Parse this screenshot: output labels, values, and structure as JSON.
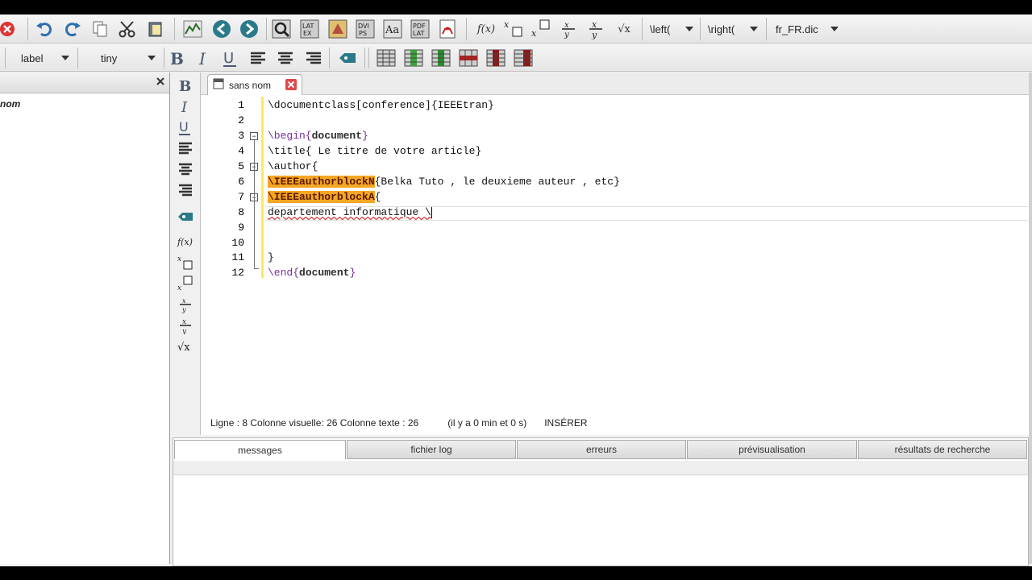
{
  "toolbar1": {
    "icons": [
      "close-icon",
      "undo-icon",
      "redo-icon",
      "copy-icon",
      "cut-icon",
      "paste-icon",
      "chart-icon",
      "arrow-left-icon",
      "arrow-right-icon",
      "quick-build-icon",
      "latex-icon",
      "pdflatex-icon",
      "dvips-icon",
      "font-icon",
      "pdf-view-icon",
      "acrobat-icon"
    ],
    "math_labels": {
      "fx": "f(x)",
      "sqrt": "√x"
    },
    "left_combo": "\\left(",
    "right_combo": "\\right(",
    "dict_combo": "fr_FR.dic"
  },
  "toolbar2": {
    "label_combo": "label",
    "size_combo": "tiny"
  },
  "leftpanel": {
    "item": "nom"
  },
  "editor": {
    "tab_label": "sans nom",
    "line_numbers": [
      "1",
      "2",
      "3",
      "4",
      "5",
      "6",
      "7",
      "8",
      "9",
      "10",
      "11",
      "12"
    ],
    "lines": {
      "l1": "\\documentclass[conference]{IEEEtran}",
      "l3a": "\\begin{",
      "l3b": "document",
      "l3c": "}",
      "l4": "\\title{ Le titre de votre article}",
      "l5": "\\author{",
      "l6hl": "\\IEEEauthorblockN",
      "l6rest": "{Belka Tuto , le deuxieme auteur , etc}",
      "l7hl": "\\IEEEauthorblockA",
      "l7rest": "{",
      "l8": "departement informatique \\",
      "l11": "}",
      "l12a": "\\end{",
      "l12b": "document",
      "l12c": "}"
    }
  },
  "statusbar": {
    "position": "Ligne : 8 Colonne visuelle: 26 Colonne texte : 26",
    "time": "(il y a 0 min et 0 s)",
    "mode": "INSÉRER"
  },
  "bottompanel": {
    "tabs": [
      "messages",
      "fichier log",
      "erreurs",
      "prévisualisation",
      "résultats de recherche"
    ]
  },
  "colors": {
    "highlight": "#f5a623",
    "gutter": "#ffe95a",
    "keyword": "#7a2e9a"
  }
}
